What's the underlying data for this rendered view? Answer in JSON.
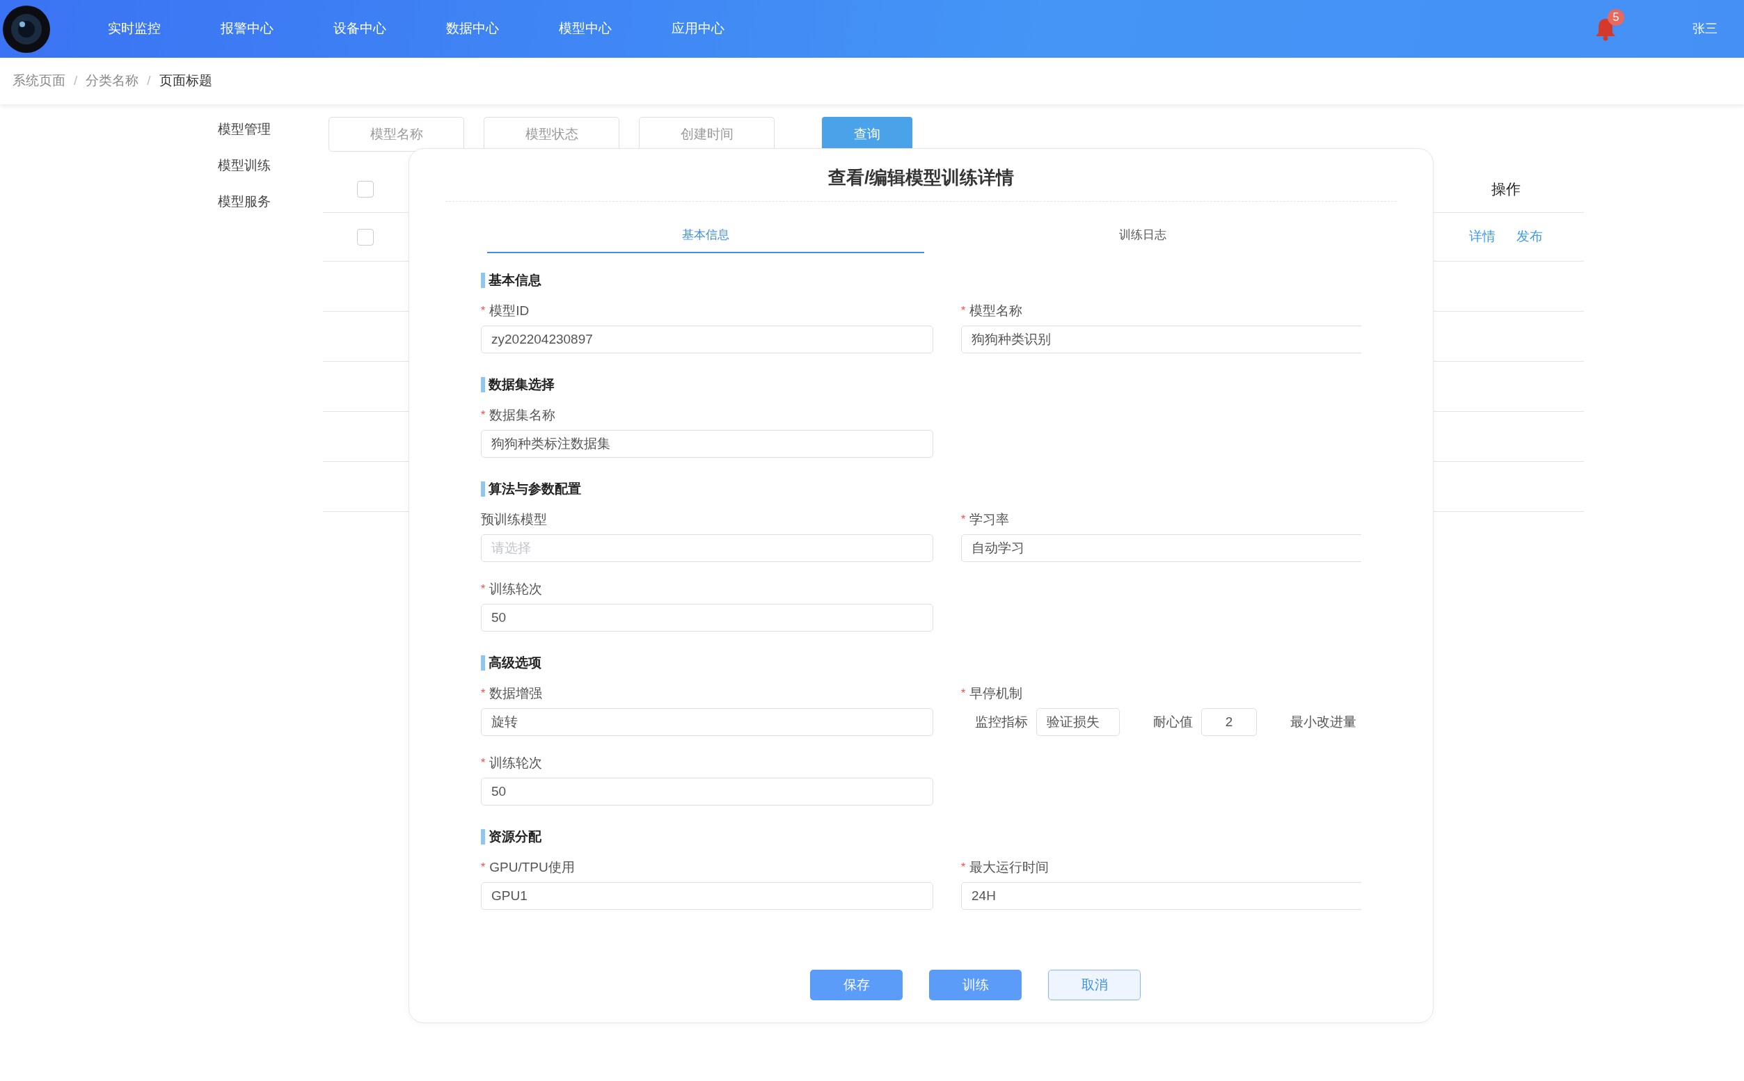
{
  "nav": {
    "items": [
      {
        "label": "实时监控"
      },
      {
        "label": "报警中心"
      },
      {
        "label": "设备中心"
      },
      {
        "label": "数据中心"
      },
      {
        "label": "模型中心"
      },
      {
        "label": "应用中心"
      }
    ],
    "notification_count": "5",
    "user": "张三"
  },
  "breadcrumb": [
    {
      "label": "系统页面"
    },
    {
      "separator": "/",
      "label": "分类名称"
    },
    {
      "separator": "/",
      "label": "页面标题"
    }
  ],
  "sidebar": {
    "items": [
      "模型管理",
      "模型训练",
      "模型服务"
    ]
  },
  "filters": {
    "fields": [
      {
        "placeholder": "模型名称"
      },
      {
        "placeholder": "模型状态"
      },
      {
        "placeholder": "创建时间"
      }
    ],
    "button": "查询"
  },
  "table": {
    "header_checked": false,
    "action_column": "操作",
    "rows": [
      {
        "checked": false,
        "actions": [
          "详情",
          "发布"
        ]
      }
    ]
  },
  "dialog": {
    "title": "查看/编辑模型训练详情",
    "tabs": [
      {
        "label": "基本信息",
        "selected": true
      },
      {
        "label": "训练日志",
        "selected": false
      }
    ],
    "sections": [
      {
        "title": "基本信息",
        "fields": [
          {
            "kind": "input",
            "label": "模型ID",
            "required_mark": "*",
            "value": "zy202204230897"
          },
          {
            "kind": "input",
            "label": "模型名称",
            "required_mark": "*",
            "value": "狗狗种类识别"
          }
        ]
      },
      {
        "title": "数据集选择",
        "fields": [
          {
            "kind": "input",
            "label": "数据集名称",
            "required_mark": "*",
            "value": "狗狗种类标注数据集"
          }
        ]
      },
      {
        "title": "算法与参数配置",
        "fields": [
          {
            "kind": "input",
            "label": "预训练模型",
            "placeholder": "请选择"
          },
          {
            "kind": "input",
            "label": "学习率",
            "required_mark": "*",
            "value": "自动学习"
          },
          {
            "kind": "input",
            "label": "训练轮次",
            "required_mark": "*",
            "value": "50"
          }
        ]
      },
      {
        "title": "高级选项",
        "fields": [
          {
            "kind": "input",
            "label": "数据增强",
            "required_mark": "*",
            "value": "旋转"
          },
          {
            "kind": "group",
            "label": "早停机制",
            "required_mark": "*",
            "parts": [
              {
                "label": "监控指标",
                "value": "验证损失"
              },
              {
                "label": "耐心值",
                "value": "2"
              },
              {
                "label": "最小改进量"
              }
            ]
          },
          {
            "kind": "input",
            "label": "训练轮次",
            "required_mark": "*",
            "value": "50"
          }
        ]
      },
      {
        "title": "资源分配",
        "fields": [
          {
            "kind": "input",
            "label": "GPU/TPU使用",
            "required_mark": "*",
            "value": "GPU1"
          },
          {
            "kind": "input",
            "label": "最大运行时间",
            "required_mark": "*",
            "value": "24H"
          }
        ]
      }
    ],
    "buttons": [
      {
        "label": "保存",
        "kind": "primary"
      },
      {
        "label": "训练",
        "kind": "primary"
      },
      {
        "label": "取消",
        "kind": "secondary"
      }
    ]
  }
}
